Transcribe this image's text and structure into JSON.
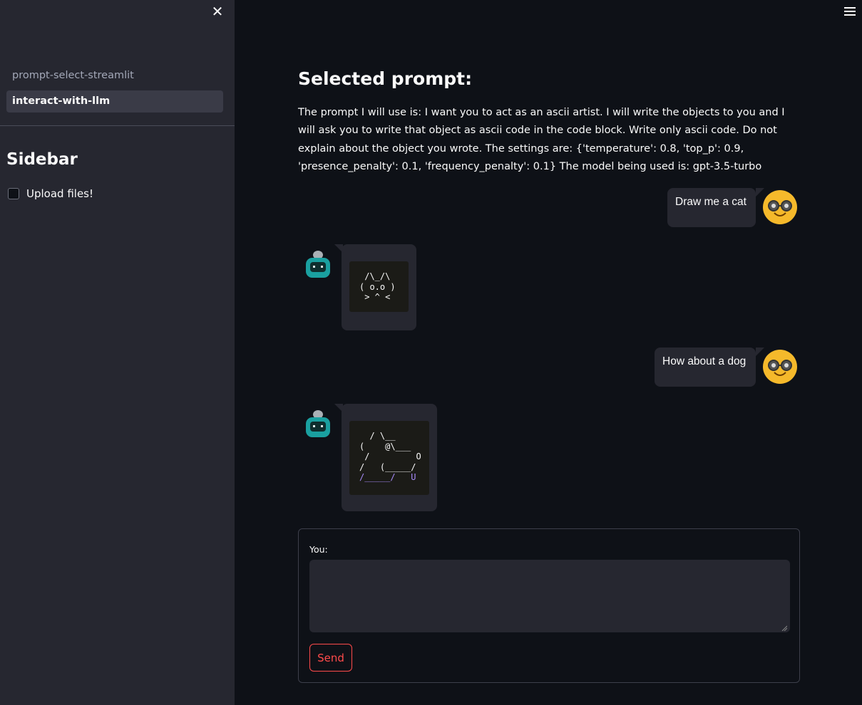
{
  "sidebar": {
    "close_icon": "close-icon",
    "nav_items": [
      {
        "label": "prompt-select-streamlit",
        "active": false
      },
      {
        "label": "interact-with-llm",
        "active": true
      }
    ],
    "title": "Sidebar",
    "checkbox_label": "Upload files!"
  },
  "main": {
    "menu_icon": "hamburger-menu-icon",
    "title": "Selected prompt:",
    "prompt_text": "The prompt I will use is: I want you to act as an ascii artist. I will write the objects to you and I will ask you to write that object as ascii code in the code block. Write only ascii code. Do not explain about the object you wrote. The settings are: {'temperature': 0.8, 'top_p': 0.9, 'presence_penalty': 0.1, 'frequency_penalty': 0.1} The model being used is: gpt-3.5-turbo"
  },
  "messages": [
    {
      "role": "user",
      "text": "Draw me a cat",
      "avatar": "nerd-face-avatar-icon"
    },
    {
      "role": "bot",
      "avatar": "robot-avatar-icon",
      "code": [
        " /\\_/\\",
        "( o.o )",
        " > ^ <"
      ]
    },
    {
      "role": "user",
      "text": "How about a dog",
      "avatar": "nerd-face-avatar-icon"
    },
    {
      "role": "bot",
      "avatar": "robot-avatar-icon",
      "code": [
        "  / \\__",
        "(    @\\___",
        " /         O",
        "/   (_____/",
        "/_____/   U"
      ]
    }
  ],
  "form": {
    "label": "You:",
    "input_value": "",
    "send_label": "Send"
  },
  "colors": {
    "background": "#0e1117",
    "sidebar": "#262730",
    "accent": "#ff4b4b",
    "avatar_user": "#f5b92b"
  }
}
